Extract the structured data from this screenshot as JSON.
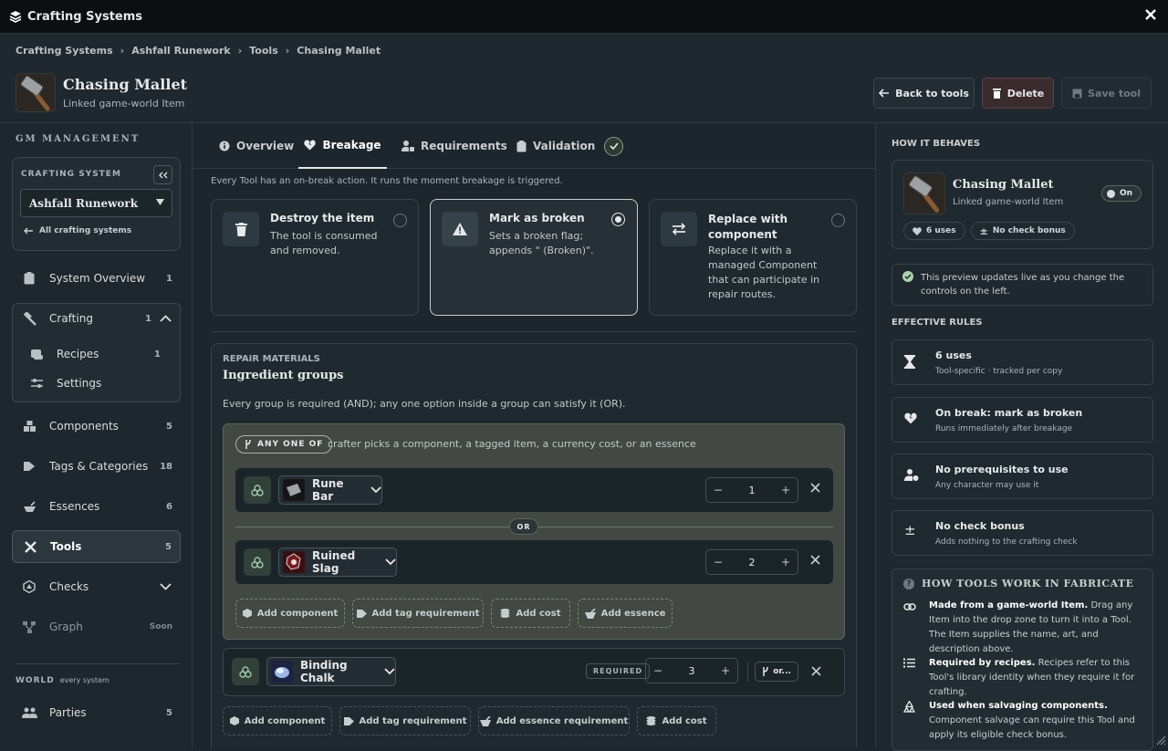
{
  "app": {
    "title": "Crafting Systems"
  },
  "breadcrumb": [
    "Crafting Systems",
    "Ashfall Runework",
    "Tools",
    "Chasing Mallet"
  ],
  "header": {
    "name": "Chasing Mallet",
    "subtitle": "Linked game-world Item",
    "back_label": "Back to tools",
    "delete_label": "Delete",
    "save_label": "Save tool"
  },
  "sidebar": {
    "section": "GM MANAGEMENT",
    "system_label": "CRAFTING SYSTEM",
    "system_value": "Ashfall Runework",
    "all_systems": "All crafting systems",
    "items": [
      {
        "label": "System Overview",
        "count": "1"
      },
      {
        "label": "Crafting",
        "count": "1"
      },
      {
        "label": "Recipes",
        "count": "1"
      },
      {
        "label": "Settings",
        "count": ""
      },
      {
        "label": "Components",
        "count": "5"
      },
      {
        "label": "Tags & Categories",
        "count": "18"
      },
      {
        "label": "Essences",
        "count": "6"
      },
      {
        "label": "Tools",
        "count": "5"
      },
      {
        "label": "Checks",
        "count": ""
      },
      {
        "label": "Graph",
        "count": "Soon"
      },
      {
        "label": "Parties",
        "count": "5"
      }
    ],
    "world_label": "WORLD",
    "world_sub": "every system"
  },
  "tabs": [
    "Overview",
    "Breakage",
    "Requirements",
    "Validation"
  ],
  "breakage": {
    "intro": "Every Tool has an on-break action. It runs the moment breakage is triggered.",
    "options": [
      {
        "title": "Destroy the item",
        "desc": "The tool is consumed and removed.",
        "selected": false
      },
      {
        "title": "Mark as broken",
        "desc": "Sets a broken flag; appends \" (Broken)\".",
        "selected": true
      },
      {
        "title": "Replace with component",
        "desc": "Replace it with a managed Component that can participate in repair routes.",
        "selected": false
      }
    ]
  },
  "repair": {
    "label": "REPAIR MATERIALS",
    "title": "Ingredient groups",
    "desc": "Every group is required (AND); any one option inside a group can satisfy it (OR).",
    "group1": {
      "badge": "ANY ONE OF",
      "hint": "crafter picks a component, a tagged item, a currency cost, or an essence",
      "rows": [
        {
          "name": "Rune Bar",
          "qty": "1"
        },
        {
          "name": "Ruined Slag",
          "qty": "2"
        }
      ],
      "or_label": "OR",
      "buttons": [
        "Add component",
        "Add tag requirement",
        "Add cost",
        "Add essence"
      ]
    },
    "group2": {
      "name": "Binding Chalk",
      "required": "REQUIRED",
      "qty": "3",
      "or_btn": "or..."
    },
    "buttons": [
      "Add component",
      "Add tag requirement",
      "Add essence requirement",
      "Add cost"
    ]
  },
  "preview": {
    "label": "HOW IT BEHAVES",
    "name": "Chasing Mallet",
    "sub": "Linked game-world Item",
    "toggle": "On",
    "chips": [
      "6 uses",
      "No check bonus"
    ],
    "note": "This preview updates live as you change the controls on the left."
  },
  "rules": {
    "label": "EFFECTIVE RULES",
    "items": [
      {
        "title": "6 uses",
        "sub": "Tool-specific · tracked per copy"
      },
      {
        "title": "On break: mark as broken",
        "sub": "Runs immediately after breakage"
      },
      {
        "title": "No prerequisites to use",
        "sub": "Any character may use it"
      },
      {
        "title": "No check bonus",
        "sub": "Adds nothing to the crafting check"
      }
    ]
  },
  "how": {
    "title": "HOW TOOLS WORK IN FABRICATE",
    "items": [
      {
        "bold": "Made from a game-world Item.",
        "text": " Drag any Item into the drop zone to turn it into a Tool. The Item supplies the name, art, and description above."
      },
      {
        "bold": "Required by recipes.",
        "text": " Recipes refer to this Tool's library identity when they require it for crafting."
      },
      {
        "bold": "Used when salvaging components.",
        "text": " Component salvage can require this Tool and apply its eligible check bonus."
      }
    ]
  }
}
